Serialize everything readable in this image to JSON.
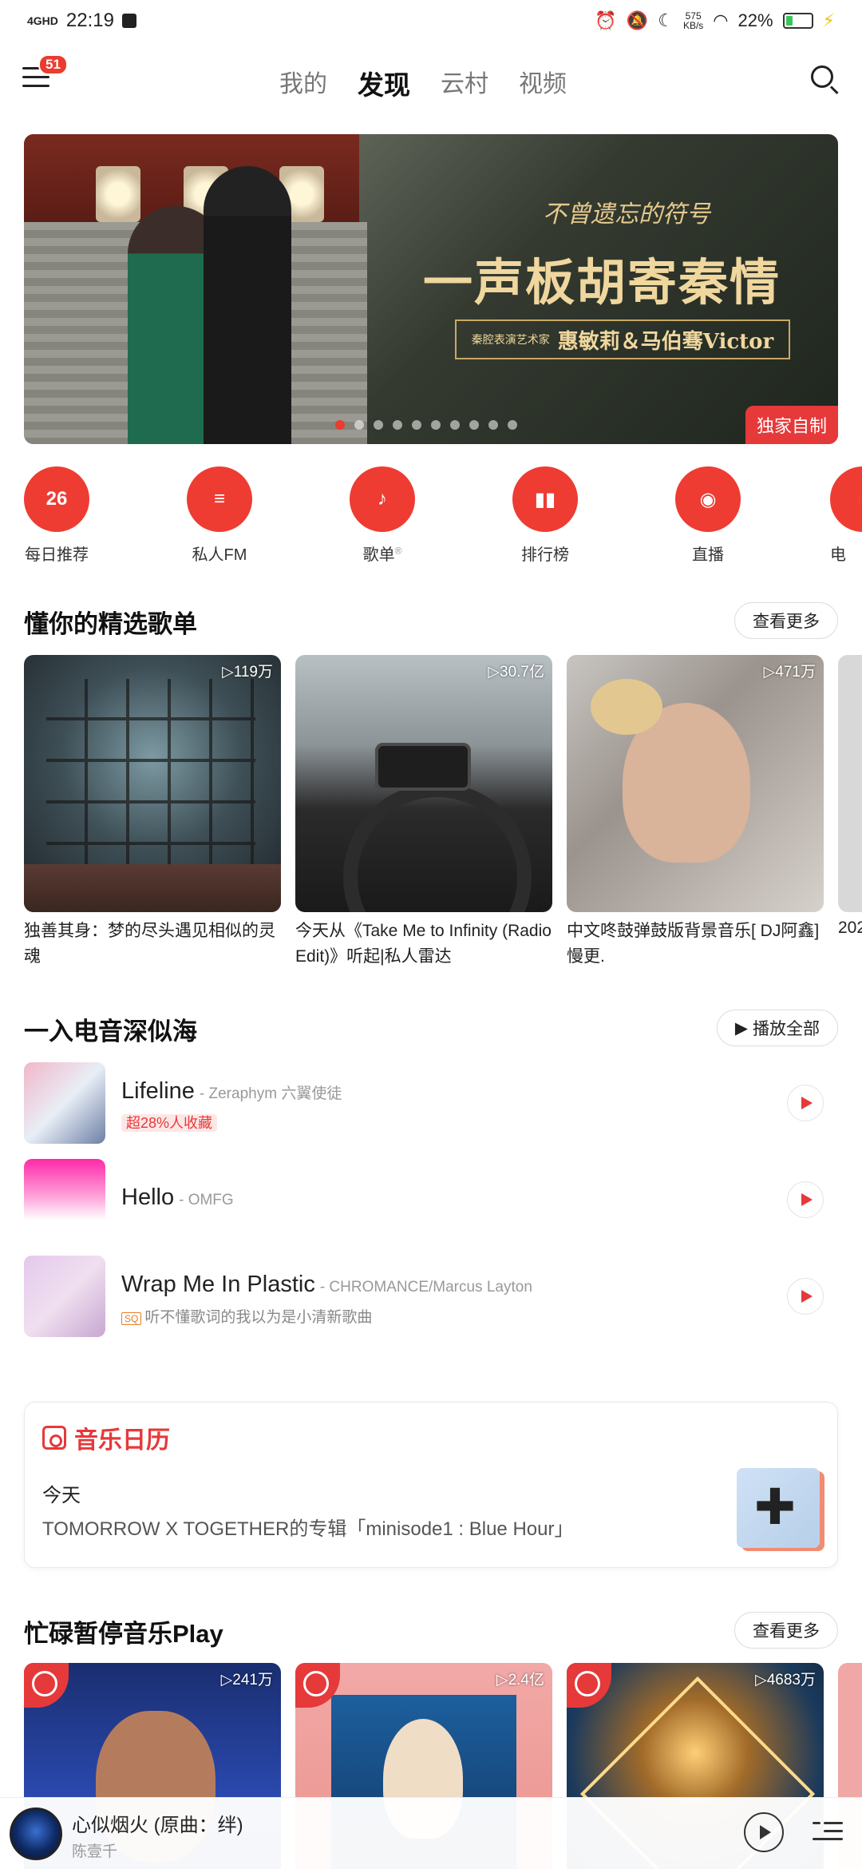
{
  "status": {
    "time": "22:19",
    "network": "4GHD",
    "speed": "575",
    "speed_unit": "KB/s",
    "battery": "22%"
  },
  "nav": {
    "badge": "51",
    "tabs": [
      "我的",
      "发现",
      "云村",
      "视频"
    ],
    "active_tab": "发现"
  },
  "banner": {
    "title_small": "不曾遗忘的符号",
    "title_main": "一声板胡寄秦情",
    "artist_note": "秦腔表演艺术家",
    "artists": "惠敏莉＆马伯骞Victor",
    "tag": "独家自制",
    "dots_total": 10,
    "dot_active": 1
  },
  "quick_entries": [
    {
      "label": "每日推荐",
      "icon": "calendar-26-icon",
      "icon_text": "26"
    },
    {
      "label": "私人FM",
      "icon": "radio-icon",
      "icon_text": "≡"
    },
    {
      "label": "歌单",
      "icon": "playlist-icon",
      "icon_text": "♪"
    },
    {
      "label": "排行榜",
      "icon": "chart-bars-icon",
      "icon_text": "▮▮"
    },
    {
      "label": "直播",
      "icon": "live-icon",
      "icon_text": "◉"
    },
    {
      "label": "电",
      "icon": "more-entry-icon",
      "icon_text": "◔"
    }
  ],
  "section_playlists": {
    "title": "懂你的精选歌单",
    "more": "查看更多",
    "items": [
      {
        "count": "119万",
        "name": "独善其身：梦的尽头遇见相似的灵魂"
      },
      {
        "count": "30.7亿",
        "name": "今天从《Take Me to Infinity (Radio Edit)》听起|私人雷达"
      },
      {
        "count": "471万",
        "name": "中文咚鼓弹鼓版背景音乐[ DJ阿鑫]慢更."
      }
    ],
    "peek_text": "202"
  },
  "section_edm": {
    "title": "一入电音深似海",
    "play_all": "播放全部",
    "songs": [
      {
        "title": "Lifeline",
        "artist": "- Zeraphym 六翼使徒",
        "sub": "超28%人收藏",
        "sub_type": "hot"
      },
      {
        "title": "Hello",
        "artist": "- OMFG",
        "sub": "",
        "sub_type": "none"
      },
      {
        "title": "Wrap Me In Plastic",
        "artist": "- CHROMANCE/Marcus Layton",
        "sub": "听不懂歌词的我以为是小清新歌曲",
        "sub_type": "sq",
        "sq_label": "SQ"
      }
    ]
  },
  "calendar": {
    "title": "音乐日历",
    "day": "今天",
    "desc": "TOMORROW X TOGETHER的专辑「minisode1 : Blue Hour」"
  },
  "section_play": {
    "title": "忙碌暂停音乐Play",
    "more": "查看更多",
    "items": [
      {
        "count": "241万"
      },
      {
        "count": "2.4亿"
      },
      {
        "count": "4683万"
      }
    ]
  },
  "player": {
    "song": "心似烟火 (原曲：绊)",
    "singer": "陈壹千"
  }
}
